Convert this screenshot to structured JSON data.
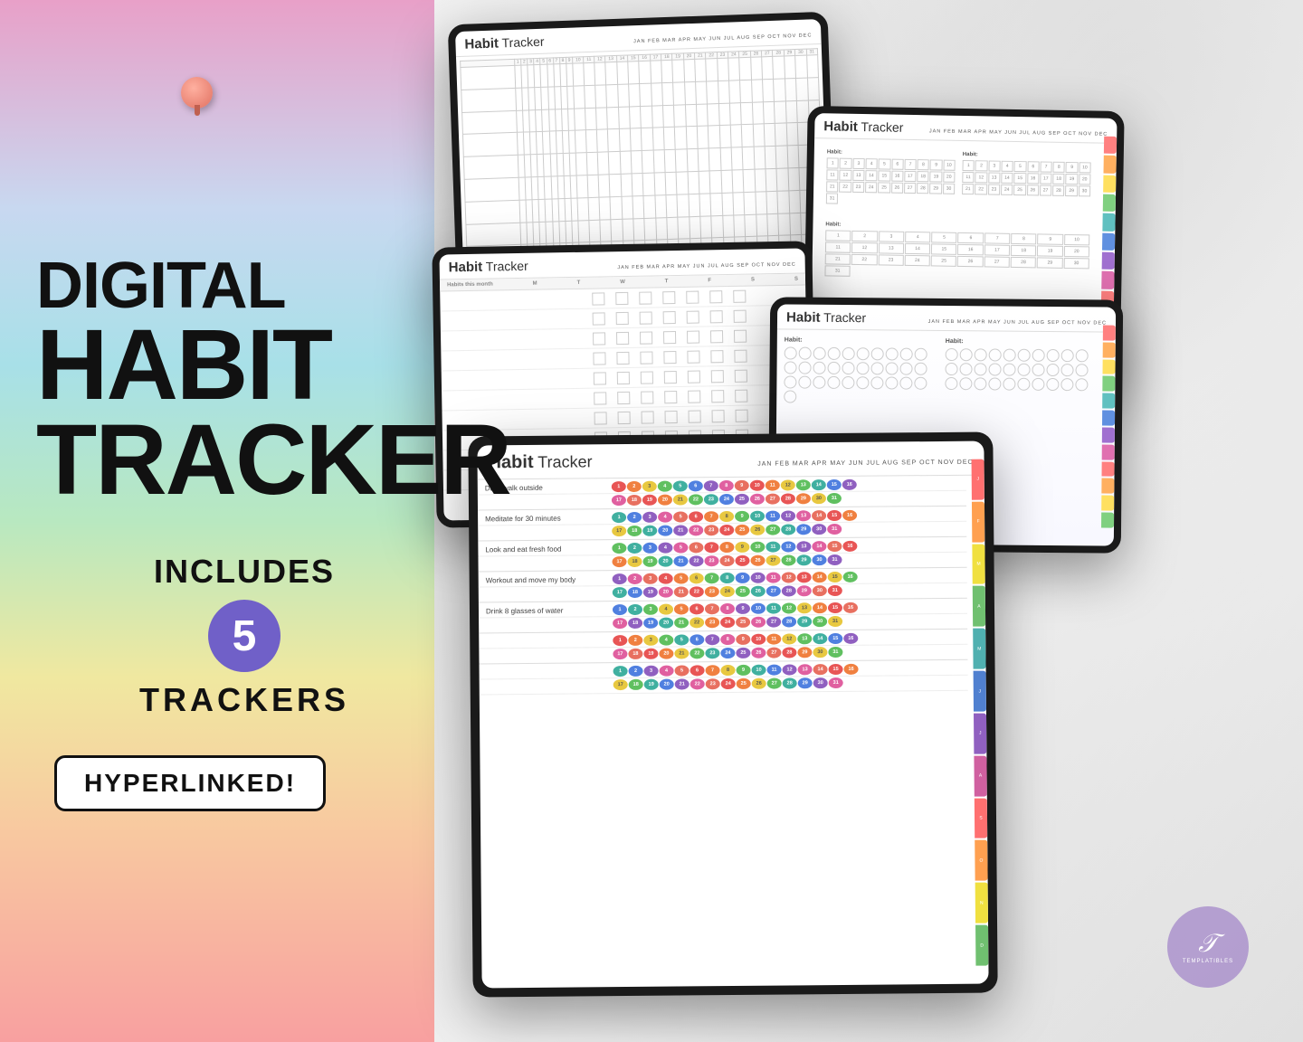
{
  "background": {
    "left_gradient": "linear-gradient pink to peach",
    "right_marble": "marble texture"
  },
  "left_panel": {
    "line1": "DIGITAL",
    "line2": "HABIT",
    "line3": "TRACKER",
    "includes_label": "INCLUDES",
    "number": "5",
    "trackers_label": "TRACKERS",
    "hyperlinked": "HYPERLINKED!"
  },
  "tablets": [
    {
      "id": "tablet-1",
      "title": "Habit",
      "title_bold": "Tracker",
      "months": "JAN FEB MAR APR MAY JUN JUL AUG SEP OCT NOV DEC",
      "type": "grid"
    },
    {
      "id": "tablet-2",
      "title": "Habit",
      "title_bold": "Tracker",
      "months": "JAN FEB MAR APR MAY JUN JUL AUG SEP OCT NOV DEC",
      "type": "calendar"
    },
    {
      "id": "tablet-3",
      "title": "Habit",
      "title_bold": "Tracker",
      "months": "JAN FEB MAR APR MAY JUN JUL AUG SEP OCT NOV DEC",
      "type": "weekly",
      "habits_label": "Habits this month",
      "days": [
        "M",
        "T",
        "W",
        "T",
        "F",
        "S",
        "S"
      ]
    },
    {
      "id": "tablet-4",
      "title": "Habit",
      "title_bold": "Tracker",
      "months": "JAN FEB MAR APR MAY JUN JUL AUG SEP OCT NOV DEC",
      "type": "circles"
    },
    {
      "id": "tablet-5",
      "title": "Habit",
      "title_bold": "Tracker",
      "months": "JAN FEB MAR APR MAY JUN JUL AUG SEP OCT NOV DEC",
      "type": "numbered",
      "habits": [
        {
          "name": "Daily walk outside"
        },
        {
          "name": "Meditate for 30 minutes"
        },
        {
          "name": "Look and eat fresh food"
        },
        {
          "name": "Workout and move my body"
        },
        {
          "name": "Drink 8 glasses of water"
        },
        {
          "name": ""
        },
        {
          "name": ""
        }
      ]
    }
  ],
  "logo": {
    "symbol": "𝒯",
    "text": "TEMPLATIBLES"
  }
}
